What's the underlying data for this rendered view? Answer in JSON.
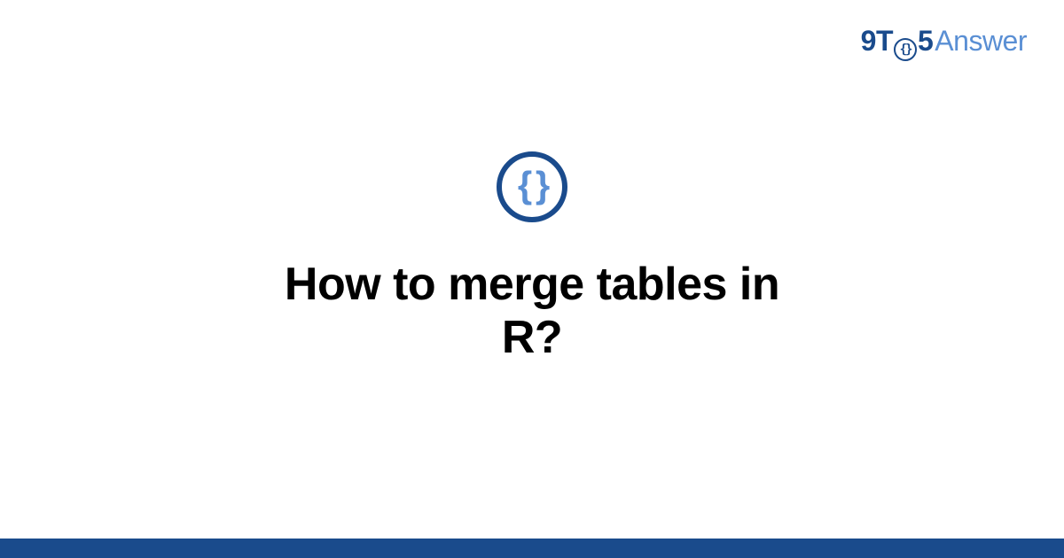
{
  "brand": {
    "part1": "9T",
    "clock_glyph": "{}",
    "part2": "5",
    "part3": "Answer"
  },
  "category_icon": {
    "glyph": "{ }",
    "semantic": "code-braces-icon"
  },
  "question": {
    "title": "How to merge tables in R?"
  },
  "colors": {
    "brand_dark": "#1a4b8c",
    "brand_light": "#5a8fd4"
  }
}
